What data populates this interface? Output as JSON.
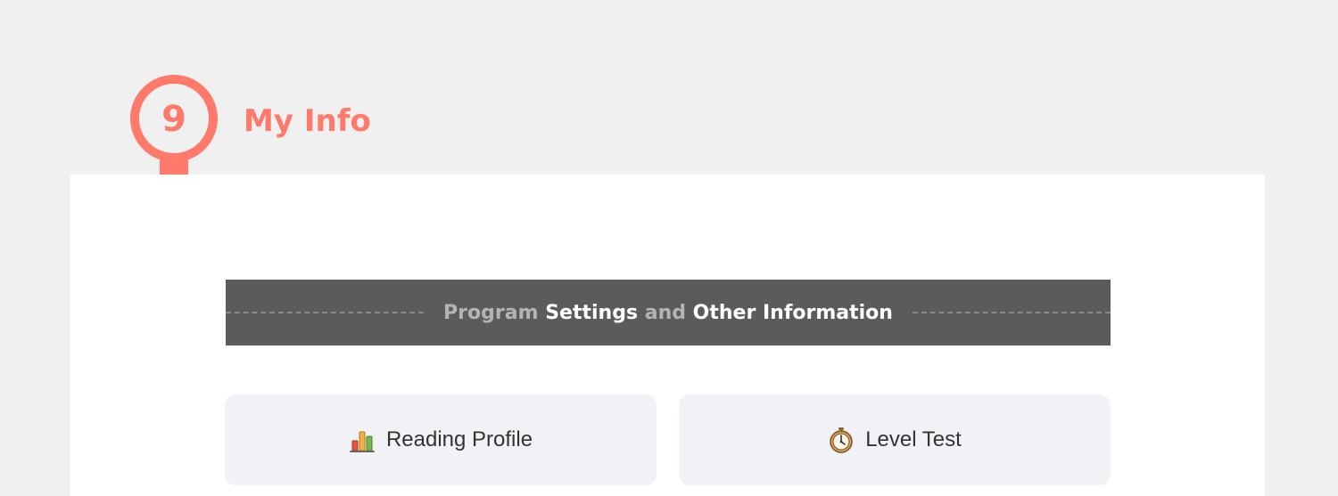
{
  "step": {
    "number": "9",
    "title": "My Info"
  },
  "section": {
    "heading_parts": [
      "Program",
      "Settings",
      "and",
      "Other Information"
    ]
  },
  "menu": [
    {
      "label": "Reading Profile",
      "icon": "bar-chart-icon"
    },
    {
      "label": "Level Test",
      "icon": "stopwatch-icon"
    }
  ],
  "colors": {
    "accent": "#ff7a6a",
    "banner": "#5b5b5b",
    "button_bg": "#f1f2f5",
    "page_bg": "#f0f0f1"
  }
}
